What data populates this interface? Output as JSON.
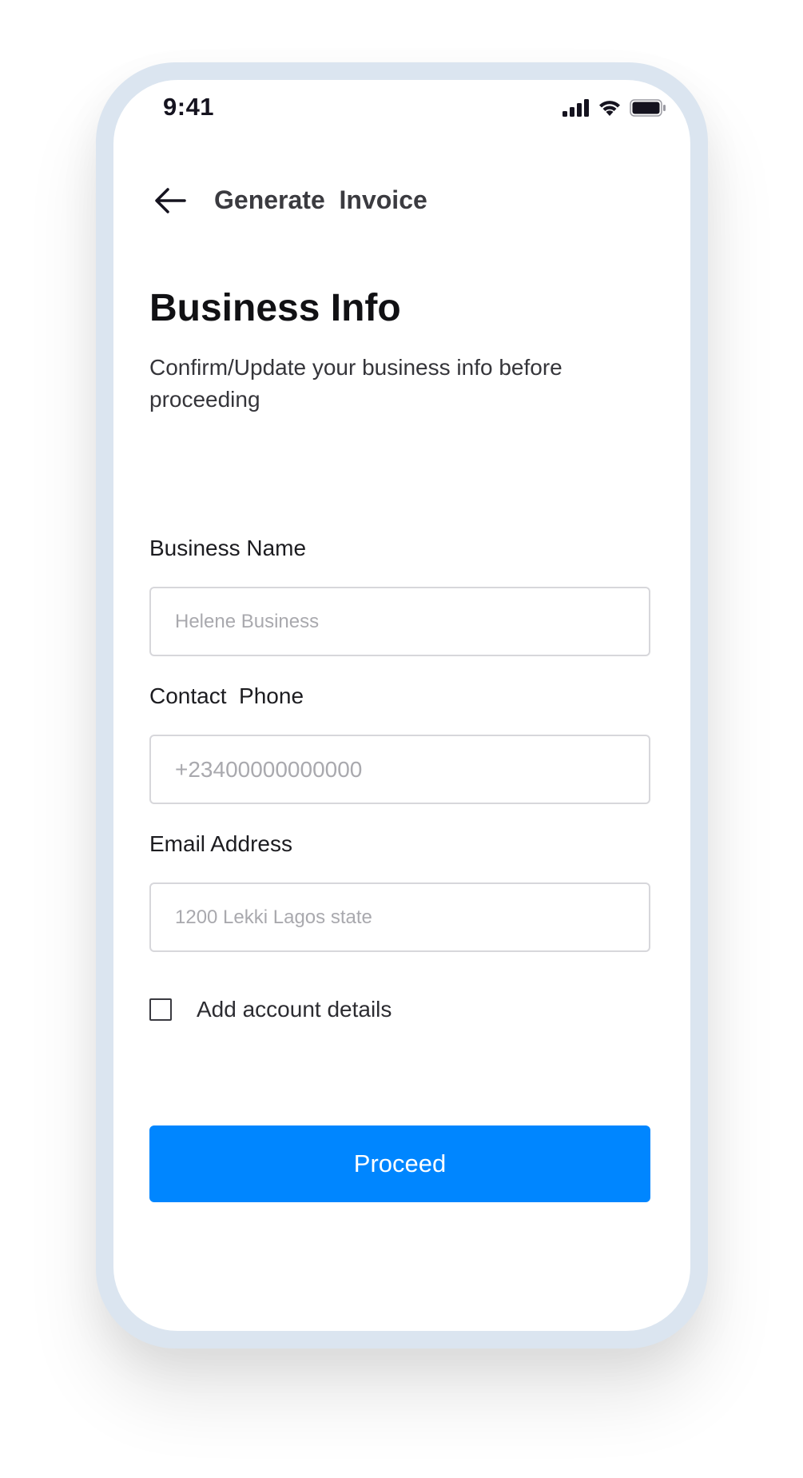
{
  "status_bar": {
    "time": "9:41",
    "icons": [
      "signal-icon",
      "wifi-icon",
      "battery-icon"
    ]
  },
  "header": {
    "back_icon": "arrow-left-icon",
    "title": "Generate  Invoice"
  },
  "main": {
    "title": "Business Info",
    "subtitle": "Confirm/Update your business info before proceeding"
  },
  "form": {
    "business_name": {
      "label": "Business Name",
      "placeholder": "Helene Business",
      "value": ""
    },
    "contact_phone": {
      "label": "Contact  Phone",
      "placeholder": "+23400000000000",
      "value": ""
    },
    "email_address": {
      "label": "Email Address",
      "placeholder": "1200 Lekki Lagos state",
      "value": ""
    },
    "add_account_details": {
      "label": "Add account details",
      "checked": false
    }
  },
  "actions": {
    "proceed_label": "Proceed"
  },
  "colors": {
    "primary": "#0086ff",
    "frame": "#dbe5f0",
    "text_dark": "#111114",
    "placeholder": "#a9a9ae",
    "input_border": "#d7d7db"
  }
}
